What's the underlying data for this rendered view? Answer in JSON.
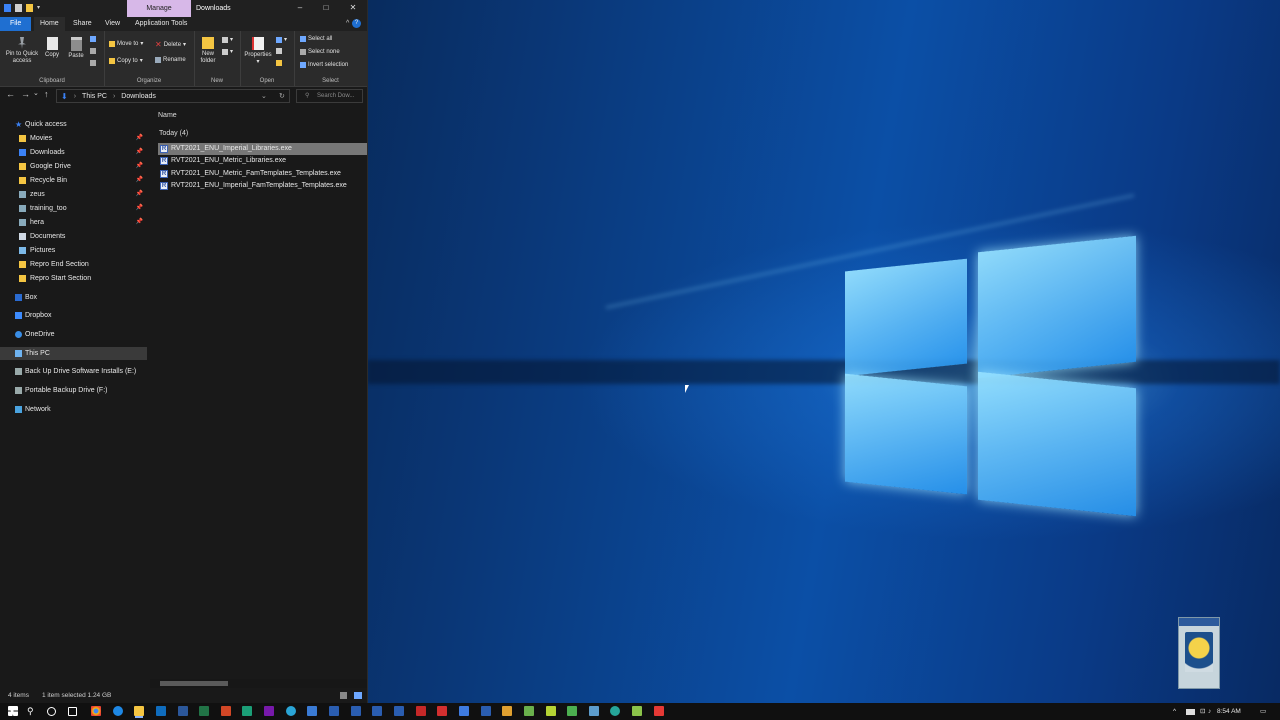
{
  "window": {
    "title": "Downloads",
    "context_tab": "Manage",
    "tabs": [
      "File",
      "Home",
      "Share",
      "View",
      "Application Tools"
    ],
    "active_tab": "Home"
  },
  "ribbon": {
    "clipboard": {
      "pin": "Pin to Quick access",
      "copy": "Copy",
      "paste": "Paste",
      "label": "Clipboard"
    },
    "organize": {
      "move_to": "Move to",
      "copy_to": "Copy to",
      "delete": "Delete",
      "rename": "Rename",
      "label": "Organize"
    },
    "new": {
      "new_folder": "New folder",
      "label": "New"
    },
    "open": {
      "properties": "Properties",
      "label": "Open"
    },
    "select": {
      "select_all": "Select all",
      "select_none": "Select none",
      "invert": "Invert selection",
      "label": "Select"
    }
  },
  "address": {
    "crumbs": [
      "This PC",
      "Downloads"
    ],
    "search_placeholder": "Search Dow..."
  },
  "nav": {
    "quick_access": "Quick access",
    "pinned": [
      "Movies",
      "Downloads",
      "Google Drive",
      "Recycle Bin",
      "zeus",
      "training_too",
      "hera"
    ],
    "recent": [
      "Documents",
      "Pictures",
      "Repro End Section",
      "Repro Start Section"
    ],
    "roots": [
      "Box",
      "Dropbox",
      "OneDrive",
      "This PC",
      "Back Up Drive Software Installs (E:)",
      "Portable Backup Drive (F:)",
      "Network"
    ]
  },
  "content": {
    "column_name": "Name",
    "group": "Today (4)",
    "files": [
      "RVT2021_ENU_Imperial_Libraries.exe",
      "RVT2021_ENU_Metric_Libraries.exe",
      "RVT2021_ENU_Metric_FamTemplates_Templates.exe",
      "RVT2021_ENU_Imperial_FamTemplates_Templates.exe"
    ],
    "file_icon_letter": "R"
  },
  "status": {
    "items": "4 items",
    "selected": "1 item selected  1.24 GB"
  },
  "taskbar": {
    "clock": "8:54 AM"
  },
  "colors": {
    "accent": "#1f6fd1",
    "manage_tab": "#d7b8e8",
    "folder": "#f4c542"
  }
}
